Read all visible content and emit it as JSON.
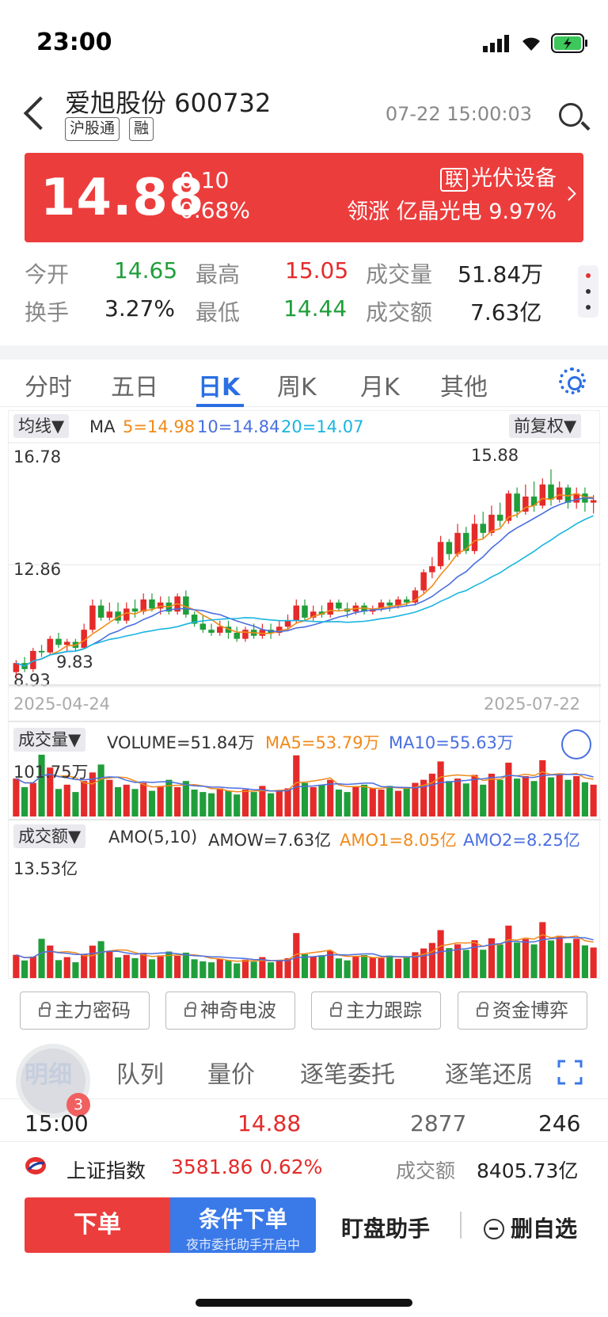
{
  "status": {
    "time": "23:00"
  },
  "header": {
    "stock_name": "爱旭股份 600732",
    "tags": [
      "沪股通",
      "融"
    ],
    "timestamp": "07-22 15:00:03"
  },
  "price": {
    "last": "14.88",
    "change": "0.10",
    "change_pct": "0.68%",
    "sector_badge": "联",
    "sector": "光伏设备",
    "leader": "领涨 亿晶光电 9.97%"
  },
  "quotes": {
    "open_label": "今开",
    "open": "14.65",
    "high_label": "最高",
    "high": "15.05",
    "volume_label": "成交量",
    "volume": "51.84万",
    "turnover_label": "换手",
    "turnover": "3.27%",
    "low_label": "最低",
    "low": "14.44",
    "amount_label": "成交额",
    "amount": "7.63亿"
  },
  "tabs": [
    "分时",
    "五日",
    "日K",
    "周K",
    "月K",
    "其他"
  ],
  "chart": {
    "ma_button": "均线▼",
    "ma_label": "MA",
    "ma5": "5=14.98",
    "ma10": "10=14.84",
    "ma20": "20=14.07",
    "adjust_button": "前复权▼",
    "price_top": "16.78",
    "price_mid": "12.86",
    "price_bottom": "8.93",
    "high_marker": "15.88",
    "low_marker": "9.83",
    "date_start": "2025-04-24",
    "date_end": "2025-07-22",
    "vol_button": "成交量▼",
    "vol_value": "VOLUME=51.84万",
    "vol_ma5": "MA5=53.79万",
    "vol_ma10": "MA10=55.63万",
    "vol_max": "101.75万",
    "amo_button": "成交额▼",
    "amo_label": "AMO(5,10)",
    "amo_value": "AMOW=7.63亿",
    "amo1": "AMO1=8.05亿",
    "amo2": "AMO2=8.25亿",
    "amo_max": "13.53亿"
  },
  "chart_data": {
    "type": "candlestick",
    "x_range": [
      "2025-04-24",
      "2025-07-22"
    ],
    "ylim": [
      8.93,
      16.78
    ],
    "candles": [
      [
        9.2,
        9.5,
        9.0,
        9.6
      ],
      [
        9.5,
        9.3,
        9.2,
        9.7
      ],
      [
        9.3,
        9.9,
        9.2,
        10.0
      ],
      [
        9.9,
        9.85,
        9.7,
        10.1
      ],
      [
        9.85,
        10.3,
        9.8,
        10.4
      ],
      [
        10.3,
        10.1,
        10.0,
        10.5
      ],
      [
        10.1,
        10.2,
        9.9,
        10.3
      ],
      [
        10.2,
        10.0,
        9.9,
        10.3
      ],
      [
        10.0,
        10.6,
        10.0,
        10.8
      ],
      [
        10.6,
        11.4,
        10.5,
        11.6
      ],
      [
        11.4,
        11.0,
        10.9,
        11.6
      ],
      [
        11.0,
        11.2,
        10.9,
        11.5
      ],
      [
        11.2,
        10.9,
        10.8,
        11.5
      ],
      [
        10.9,
        11.3,
        10.8,
        11.5
      ],
      [
        11.3,
        11.2,
        11.0,
        11.6
      ],
      [
        11.2,
        11.6,
        11.1,
        11.8
      ],
      [
        11.6,
        11.3,
        11.2,
        11.8
      ],
      [
        11.3,
        11.5,
        11.1,
        11.7
      ],
      [
        11.5,
        11.2,
        11.1,
        11.7
      ],
      [
        11.2,
        11.7,
        11.1,
        11.8
      ],
      [
        11.7,
        11.1,
        11.0,
        11.9
      ],
      [
        11.1,
        10.8,
        10.7,
        11.2
      ],
      [
        10.8,
        10.6,
        10.5,
        11.1
      ],
      [
        10.6,
        10.5,
        10.4,
        10.8
      ],
      [
        10.5,
        10.7,
        10.4,
        10.9
      ],
      [
        10.7,
        10.5,
        10.3,
        10.9
      ],
      [
        10.5,
        10.3,
        10.2,
        10.7
      ],
      [
        10.3,
        10.6,
        10.2,
        10.7
      ],
      [
        10.6,
        10.4,
        10.3,
        10.8
      ],
      [
        10.4,
        10.6,
        10.3,
        10.8
      ],
      [
        10.6,
        10.5,
        10.3,
        10.8
      ],
      [
        10.5,
        10.7,
        10.4,
        10.9
      ],
      [
        10.7,
        10.9,
        10.6,
        11.1
      ],
      [
        10.9,
        11.4,
        10.8,
        11.6
      ],
      [
        11.4,
        11.0,
        10.9,
        11.6
      ],
      [
        11.0,
        11.2,
        10.9,
        11.4
      ],
      [
        11.2,
        11.1,
        11.0,
        11.4
      ],
      [
        11.1,
        11.5,
        11.0,
        11.6
      ],
      [
        11.5,
        11.3,
        11.2,
        11.6
      ],
      [
        11.3,
        11.2,
        11.0,
        11.5
      ],
      [
        11.2,
        11.4,
        11.1,
        11.5
      ],
      [
        11.4,
        11.2,
        11.1,
        11.5
      ],
      [
        11.2,
        11.3,
        11.1,
        11.4
      ],
      [
        11.3,
        11.5,
        11.2,
        11.6
      ],
      [
        11.5,
        11.4,
        11.2,
        11.6
      ],
      [
        11.4,
        11.6,
        11.3,
        11.7
      ],
      [
        11.6,
        11.5,
        11.4,
        11.7
      ],
      [
        11.5,
        11.9,
        11.4,
        12.0
      ],
      [
        11.9,
        12.5,
        11.8,
        12.6
      ],
      [
        12.5,
        12.7,
        12.3,
        13.0
      ],
      [
        12.7,
        13.5,
        12.6,
        13.7
      ],
      [
        13.5,
        13.1,
        12.9,
        13.6
      ],
      [
        13.1,
        13.8,
        13.0,
        14.1
      ],
      [
        13.8,
        13.2,
        13.1,
        14.0
      ],
      [
        13.2,
        14.1,
        13.1,
        14.4
      ],
      [
        14.1,
        13.8,
        13.6,
        14.5
      ],
      [
        13.8,
        14.4,
        13.7,
        14.7
      ],
      [
        14.4,
        14.2,
        14.0,
        14.8
      ],
      [
        14.2,
        15.1,
        14.1,
        15.2
      ],
      [
        15.1,
        14.5,
        14.3,
        15.3
      ],
      [
        14.5,
        15.0,
        14.4,
        15.4
      ],
      [
        15.0,
        14.7,
        14.5,
        15.5
      ],
      [
        14.7,
        15.4,
        14.6,
        15.6
      ],
      [
        15.4,
        14.9,
        14.7,
        15.9
      ],
      [
        14.9,
        15.3,
        14.8,
        15.5
      ],
      [
        15.3,
        14.8,
        14.6,
        15.4
      ],
      [
        14.8,
        15.1,
        14.6,
        15.3
      ],
      [
        15.1,
        14.8,
        14.5,
        15.3
      ],
      [
        14.8,
        14.88,
        14.44,
        15.05
      ]
    ],
    "volume": [
      62,
      48,
      55,
      101,
      80,
      45,
      52,
      40,
      58,
      72,
      85,
      60,
      48,
      52,
      45,
      55,
      42,
      50,
      60,
      48,
      58,
      44,
      40,
      38,
      46,
      42,
      36,
      44,
      40,
      50,
      38,
      42,
      46,
      100,
      55,
      48,
      52,
      60,
      44,
      40,
      48,
      52,
      46,
      44,
      50,
      42,
      48,
      55,
      60,
      70,
      90,
      58,
      62,
      54,
      68,
      52,
      70,
      60,
      88,
      62,
      66,
      58,
      92,
      64,
      70,
      60,
      66,
      56,
      52
    ]
  },
  "modules": [
    "主力密码",
    "神奇电波",
    "主力跟踪",
    "资金博弈"
  ],
  "detail_tabs": [
    "明细",
    "队列",
    "量价",
    "逐笔委托",
    "逐笔还原"
  ],
  "badge_count": "3",
  "tick": {
    "time": "15:00",
    "price": "14.88",
    "volume": "2877",
    "count": "246"
  },
  "index": {
    "name": "上证指数",
    "value": "3581.86",
    "pct": "0.62%",
    "amount_label": "成交额",
    "amount": "8405.73亿"
  },
  "bottom": {
    "order": "下单",
    "cond": "条件下单",
    "cond_sub": "夜市委托助手开启中",
    "helper": "盯盘助手",
    "remove": "删自选"
  }
}
